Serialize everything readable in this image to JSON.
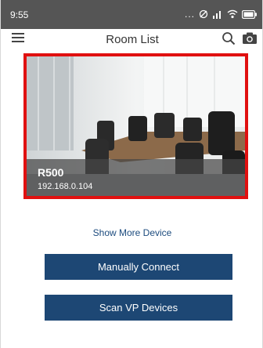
{
  "status_bar": {
    "time": "9:55",
    "signal_dots": "...",
    "icons": [
      "silent-icon",
      "signal-icon",
      "wifi-icon",
      "battery-icon"
    ]
  },
  "header": {
    "title": "Room List",
    "icons": [
      "menu-icon",
      "search-icon",
      "camera-icon"
    ]
  },
  "room": {
    "name": "R500",
    "ip": "192.168.0.104",
    "highlight_color": "#e01010"
  },
  "show_more_label": "Show More Device",
  "buttons": {
    "manual_connect": "Manually Connect",
    "scan": "Scan VP Devices"
  },
  "colors": {
    "primary": "#1d4774",
    "link": "#1c4b7e",
    "status_bar": "#555555"
  }
}
